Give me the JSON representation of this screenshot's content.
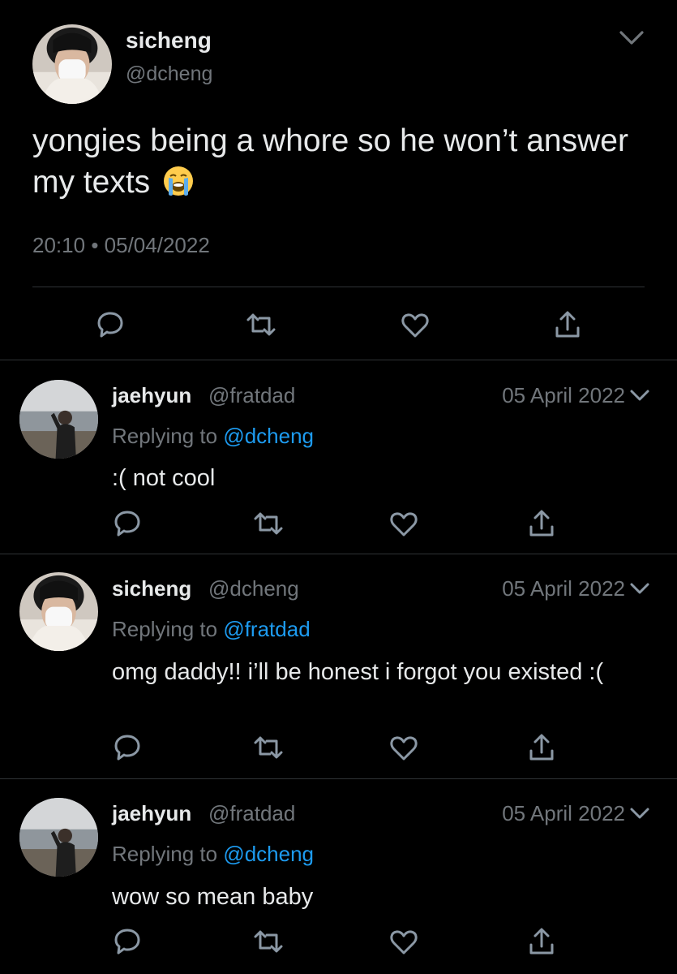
{
  "main_tweet": {
    "name": "sicheng",
    "handle": "@dcheng",
    "text": "yongies being a whore so he won’t answer my texts",
    "emoji": "loudly-crying-face-emoji",
    "time": "20:10",
    "separator": "•",
    "date": "05/04/2022",
    "actions": [
      "reply-icon",
      "retweet-icon",
      "like-icon",
      "share-icon"
    ]
  },
  "replies": [
    {
      "name": "jaehyun",
      "handle": "@fratdad",
      "date": "05 April 2022",
      "replying_prefix": "Replying to",
      "replying_to": "@dcheng",
      "text": ":( not cool"
    },
    {
      "name": "sicheng",
      "handle": "@dcheng",
      "date": "05 April 2022",
      "replying_prefix": "Replying to",
      "replying_to": "@fratdad",
      "text": "omg daddy!! i’ll be honest i forgot you existed :("
    },
    {
      "name": "jaehyun",
      "handle": "@fratdad",
      "date": "05 April 2022",
      "replying_prefix": "Replying to",
      "replying_to": "@dcheng",
      "text": "wow so mean baby"
    }
  ],
  "colors": {
    "background": "#000000",
    "text": "#e7e9ea",
    "secondary": "#71767b",
    "mention": "#1d9bf0",
    "divider": "#2f3336"
  }
}
